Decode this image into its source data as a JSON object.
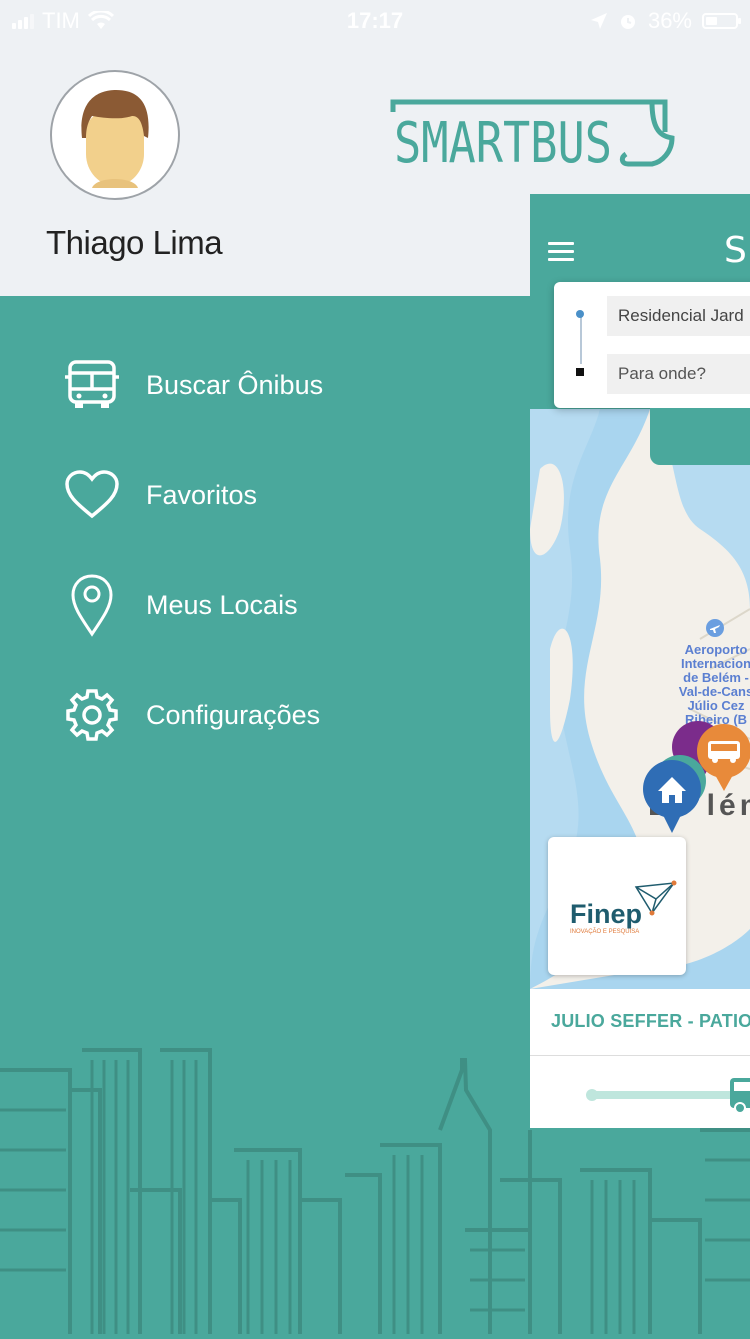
{
  "status_bar": {
    "carrier": "TIM",
    "time": "17:17",
    "battery": "36%"
  },
  "profile": {
    "name": "Thiago Lima"
  },
  "brand": {
    "logo_text": "SMARTBUS",
    "colors": {
      "primary": "#4aa89c",
      "header_bg": "#eef1f4",
      "logo": "#4aa89c"
    }
  },
  "menu": {
    "items": [
      {
        "label": "Buscar Ônibus",
        "icon": "bus-icon"
      },
      {
        "label": "Favoritos",
        "icon": "heart-icon"
      },
      {
        "label": "Meus Locais",
        "icon": "location-pin-icon"
      },
      {
        "label": "Configurações",
        "icon": "gear-icon"
      }
    ]
  },
  "preview": {
    "origin_value": "Residencial Jard",
    "destination_placeholder": "Para onde?",
    "map_label": "Aeroporto Internacional de Belém - Val-de-Cans Júlio Cezar Ribeiro",
    "map_label_lines": [
      "Aeroporto",
      "Internacion",
      "de Belém -",
      "Val-de-Cans",
      "Júlio Cez",
      "Ribeiro (B"
    ],
    "city_label": "Belém",
    "city_label_visible": "Bé lém",
    "sponsor": {
      "name": "Finep",
      "tagline": "INOVAÇÃO E PESQUISA"
    },
    "route_name": "JULIO SEFFER - PATIO B"
  }
}
